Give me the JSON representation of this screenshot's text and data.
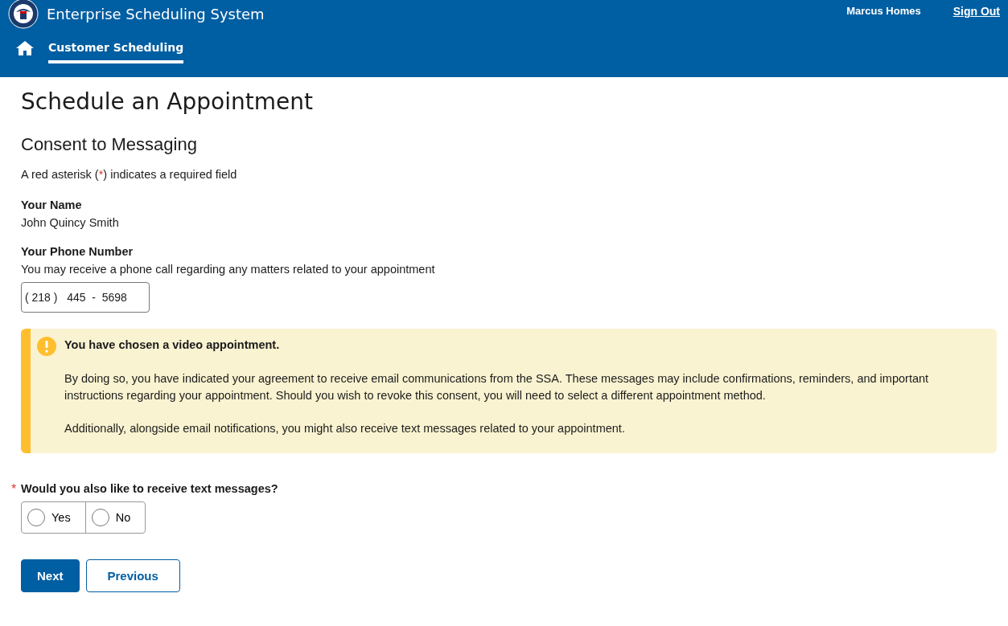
{
  "header": {
    "title": "Enterprise Scheduling System",
    "user": "Marcus Homes",
    "sign_out": "Sign Out"
  },
  "nav": [
    {
      "label": "Customer Scheduling",
      "selected": true
    }
  ],
  "page_title": "Schedule an Appointment",
  "section_title": "Consent to Messaging",
  "legend": {
    "before": "A red asterisk (",
    "mark": "*",
    "after": ") indicates a required field"
  },
  "name": {
    "label": "Your Name",
    "value": "John Quincy Smith"
  },
  "phone": {
    "label": "Your Phone Number",
    "hint": "You may receive a phone call regarding any matters related to your appointment",
    "value": "( 218 )   445  -  5698"
  },
  "alert": {
    "title": "You have chosen a video appointment.",
    "paragraphs": [
      "By doing so, you have indicated your agreement to receive email communications from the SSA. These messages may include confirmations, reminders, and important instructions regarding your appointment. Should you wish to revoke this consent, you will need to select a different appointment method.",
      "Additionally, alongside email notifications, you might also receive text messages related to your appointment."
    ]
  },
  "question": {
    "required": true,
    "required_mark": "*",
    "label": "Would you also like to receive text messages?",
    "options": [
      {
        "label": "Yes",
        "selected": false
      },
      {
        "label": "No",
        "selected": false
      }
    ]
  },
  "buttons": [
    {
      "label": "Next",
      "kind": "primary"
    },
    {
      "label": "Previous",
      "kind": "secondary"
    }
  ]
}
